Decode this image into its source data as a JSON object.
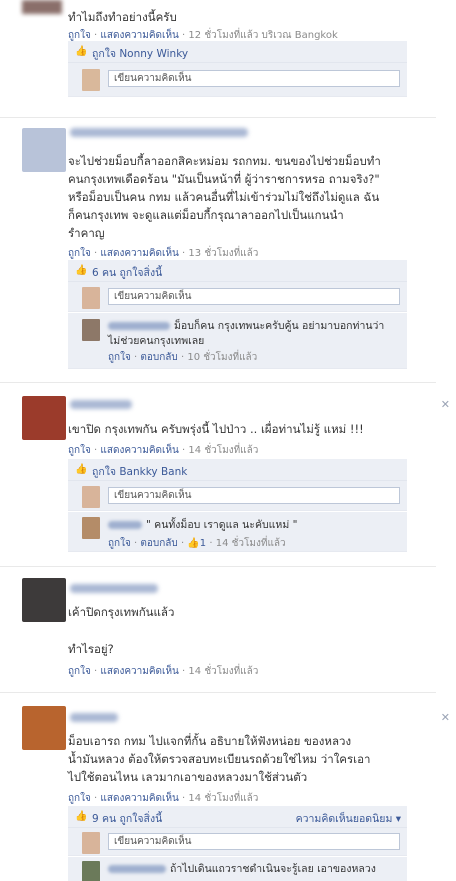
{
  "posts": [
    {
      "message": "ทำไมถึงทำอย่างนี้ครับ",
      "actions": {
        "like": "ถูกใจ",
        "comment": "แสดงความคิดเห็น",
        "time": "12 ชั่วโมงที่แล้ว",
        "place": "บริเวณ Bangkok"
      },
      "likes": "ถูกใจ Nonny Winky",
      "comment_placeholder": "เขียนความคิดเห็น"
    },
    {
      "message_lines": [
        "จะไปช่วยม็อบกี้ลาออกสิคะหม่อม รถกทม. ขนของไปช่วยม็อบทำ",
        "คนกรุงเทพเดือดร้อน \"มันเป็นหน้าที่ ผู้ว่าราชการหรอ ถามจริง?\"",
        "หรือม็อบเป็นคน กทม แล้วคนอื่นที่ไม่เข้าร่วมไม่ใช่ถึงไม่ดูแล ฉัน",
        "ก็คนกรุงเทพ จะดูแลแต่ม็อบกี้กรุณาลาออกไปเป็นแกนนำ",
        "รำคาญ"
      ],
      "actions": {
        "like": "ถูกใจ",
        "comment": "แสดงความคิดเห็น",
        "time": "13 ชั่วโมงที่แล้ว"
      },
      "likes": "6 คน ถูกใจสิ่งนี้",
      "comment_placeholder": "เขียนความคิดเห็น",
      "reply": {
        "lines": [
          "ม็อบก็คน กรุงเทพนะครับคู้น อย่ามาบอกท่านว่า",
          "ไม่ช่วยคนกรุงเทพเลย"
        ],
        "like": "ถูกใจ",
        "reply_label": "ตอบกลับ",
        "time": "10 ชั่วโมงที่แล้ว"
      }
    },
    {
      "message": "เขาปิด กรุงเทพกัน ครับพรุ่งนี้ ไปป่าว .. เผื่อท่านไม่รู้ แหม่ !!!",
      "actions": {
        "like": "ถูกใจ",
        "comment": "แสดงความคิดเห็น",
        "time": "14 ชั่วโมงที่แล้ว"
      },
      "likes": "ถูกใจ Bankky Bank",
      "comment_placeholder": "เขียนความคิดเห็น",
      "reply": {
        "lines": [
          "\" คนทั้งม็อบ เราดูแล นะคับแหม่ \""
        ],
        "like": "ถูกใจ",
        "reply_label": "ตอบกลับ",
        "like_count": "1",
        "time": "14 ชั่วโมงที่แล้ว"
      }
    },
    {
      "message": "เค้าปิดกรุงเทพกันแล้ว",
      "message2": "ทำไรอยู่?",
      "actions": {
        "like": "ถูกใจ",
        "comment": "แสดงความคิดเห็น",
        "time": "14 ชั่วโมงที่แล้ว"
      }
    },
    {
      "message_lines": [
        "ม็อบเอารถ กทม ไปแจกที่กั้น อธิบายให้ฟังหน่อย ของหลวง",
        "น้ำมันหลวง ต้องให้ตรวจสอบทะเบียนรถด้วยใช่ไหม ว่าใครเอา",
        "ไปใช้ตอนไหน เลวมากเอาของหลวงมาใช้ส่วนตัว"
      ],
      "actions": {
        "like": "ถูกใจ",
        "comment": "แสดงความคิดเห็น",
        "time": "14 ชั่วโมงที่แล้ว"
      },
      "likes": "9 คน ถูกใจสิ่งนี้",
      "top_comments": "ความคิดเห็นยอดนิยม",
      "comment_placeholder": "เขียนความคิดเห็น",
      "reply": {
        "lines": [
          "ถ้าไปเดินแถวราชดำเนินจะรู้เลย เอาของหลวง"
        ]
      }
    }
  ],
  "icons": {
    "close": "close-icon",
    "like": "thumbs-up-icon"
  },
  "colors": {
    "link": "#3b5998",
    "panel": "#eceff5",
    "meta": "#8a8a8a"
  }
}
